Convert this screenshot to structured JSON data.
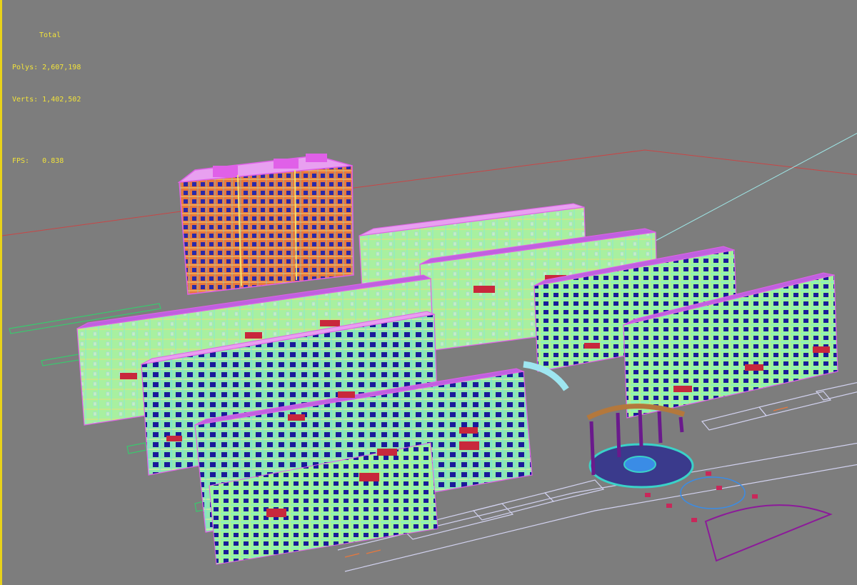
{
  "viewport": {
    "background": "#7d7d7d",
    "frame_color": "#e8d21a"
  },
  "stats": {
    "title": "Total",
    "polys_label": "Polys:",
    "polys_value": "2,607,198",
    "verts_label": "Verts:",
    "verts_value": "1,402,502",
    "fps_label": "FPS:",
    "fps_value": "0.838",
    "color": "#f2e33a"
  },
  "scene": {
    "description_icon": "wireframe-residential-complex",
    "palette": {
      "wire_green": "#9bf59b",
      "wire_cyan": "#7fe8e0",
      "wire_yellow": "#e8e07a",
      "magenta": "#e060e8",
      "window_blue": "#1a1a9a",
      "roof_red": "#c8283c",
      "tower_orange": "#e8783c",
      "ground_lines": "#d2d2f0",
      "axis_red": "#c84646",
      "axis_cyan": "#9ee6e6",
      "pergola_purple": "#6a1a8c",
      "plaza_cyan": "#3ad2c8",
      "fountain_blue": "#3a8ce6"
    }
  }
}
